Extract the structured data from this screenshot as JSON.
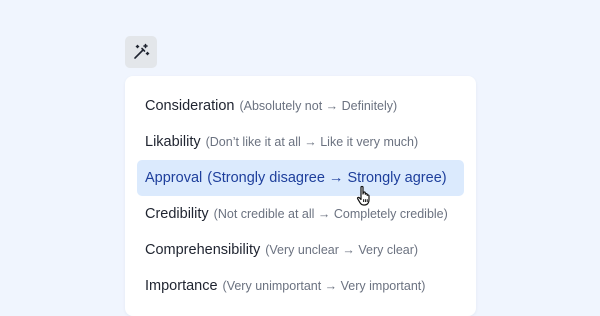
{
  "toolbar": {
    "magic_icon": "magic-wand-sparkle-icon"
  },
  "menu": {
    "items": [
      {
        "label": "Consideration",
        "range": "(Absolutely not → Definitely)"
      },
      {
        "label": "Likability",
        "range": "(Don’t like it at all → Like it very much)"
      },
      {
        "label": "Approval",
        "range": "(Strongly disagree → Strongly agree)",
        "hovered": true
      },
      {
        "label": "Credibility",
        "range": "(Not credible at all → Completely credible)"
      },
      {
        "label": "Comprehensibility",
        "range": "(Very unclear → Very clear)"
      },
      {
        "label": "Importance",
        "range": "(Very unimportant → Very important)"
      }
    ]
  },
  "colors": {
    "background": "#f0f5fe",
    "highlight": "#dbeafd",
    "highlight_text": "#1e3f9c"
  },
  "cursor": "pointer-hand-icon"
}
